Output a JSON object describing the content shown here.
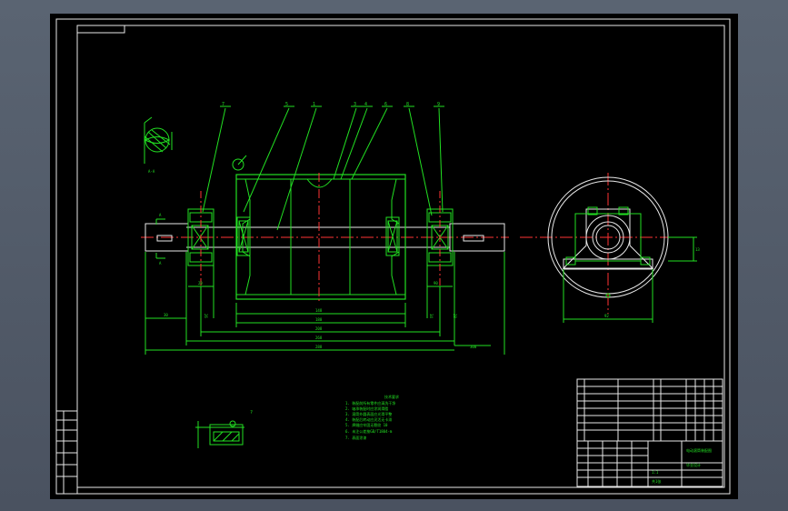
{
  "drawing": {
    "part_balloons": [
      "7",
      "5",
      "1",
      "3",
      "4",
      "6",
      "8",
      "9"
    ],
    "section_labels": [
      "A-A",
      "A",
      "A"
    ],
    "detail_label": "?",
    "overall_dims": [
      "148",
      "180",
      "208",
      "268",
      "288",
      "308"
    ],
    "small_dims": [
      "20",
      "26",
      "30",
      "90",
      "34",
      "28"
    ],
    "end_view_dims": [
      "92",
      "13"
    ],
    "notes_title": "技术要求",
    "notes_lines": [
      "1. 装配前所有零件应清洗干净",
      "2. 轴承装配时应涂润滑脂",
      "3. 滚筒外圆表面应光滑平整",
      "4. 装配后转动应灵活无卡滞",
      "5. 焊缝应牢固无裂纹 10",
      "6. 未注公差按GB/T1804-m",
      "7. 表面涂漆"
    ],
    "title_block": {
      "drawing_name": "电动滚筒装配图",
      "project": "毕业设计",
      "scale": "1:1",
      "sheet": "共1张"
    },
    "revision_rows": [
      "",
      "",
      "",
      "",
      "",
      "",
      "",
      "",
      ""
    ]
  },
  "colors": {
    "background": "#000000",
    "lines": "#22e022",
    "frame": "#e8e8e8",
    "centerlines": "#ff3333",
    "hatching": "#33e0e0"
  }
}
